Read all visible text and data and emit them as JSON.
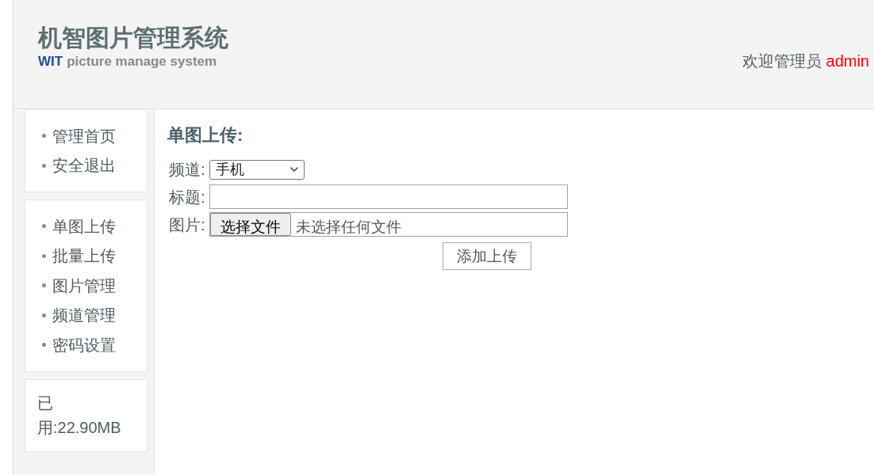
{
  "header": {
    "logo": {
      "title": "机智图片管理系统",
      "brand": "WIT",
      "subtitle": "picture manage system"
    },
    "welcome": {
      "text": "欢迎管理员",
      "username": "admin"
    }
  },
  "sidebar": {
    "menus": [
      {
        "items": [
          {
            "label": "管理首页"
          },
          {
            "label": "安全退出"
          }
        ]
      },
      {
        "items": [
          {
            "label": "单图上传"
          },
          {
            "label": "批量上传"
          },
          {
            "label": "图片管理"
          },
          {
            "label": "频道管理"
          },
          {
            "label": "密码设置"
          }
        ]
      }
    ],
    "usage": "已用:22.90MB"
  },
  "form": {
    "title": "单图上传:",
    "fields": [
      {
        "kind": "select",
        "label": "频道:",
        "value": "手机"
      },
      {
        "kind": "text",
        "label": "标题:"
      },
      {
        "kind": "file",
        "label": "图片:",
        "button": "选择文件",
        "status": "未选择任何文件"
      }
    ],
    "submit": "添加上传"
  }
}
